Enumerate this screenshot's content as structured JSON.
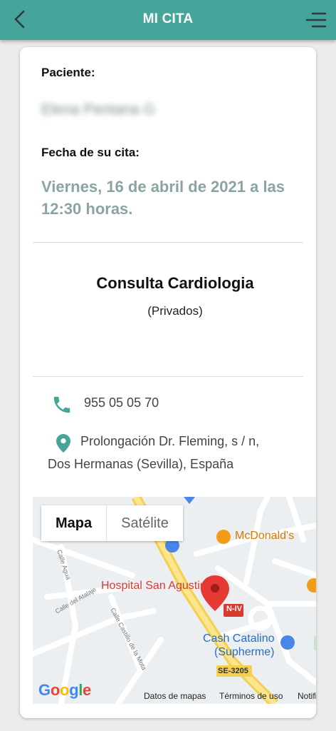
{
  "header": {
    "title": "MI CITA",
    "back_icon": "chevron-left-icon",
    "menu_icon": "menu-icon",
    "color": "#45a59b"
  },
  "appointment": {
    "patient_label": "Paciente:",
    "patient_name": "Elena Pentana G",
    "date_label": "Fecha de su cita:",
    "date_value": "Viernes, 16 de abril de 2021 a las 12:30 horas.",
    "service_name": "Consulta Cardiologia",
    "service_type": "(Privados)",
    "phone": "955 05 05 70",
    "address_line1": "Prolongación Dr. Fleming, s / n,",
    "address_line2": "Dos Hermanas (Sevilla), España"
  },
  "map": {
    "type_map": "Mapa",
    "type_satellite": "Satélite",
    "poi_mcdonalds": "McDonald's",
    "poi_hospital": "Hospital San Agustin",
    "poi_cash1": "Cash Catalino",
    "poi_cash2": "(Supherme)",
    "road_niv": "N-IV",
    "road_se3205": "SE-3205",
    "street_agua": "Calle Agua",
    "street_atalaje": "Calle del Atalaje",
    "street_castillo": "Calle Castillo de la Mota",
    "google": [
      "G",
      "o",
      "o",
      "g",
      "l",
      "e"
    ],
    "attribution_data": "Datos de mapas",
    "attribution_terms": "Términos de uso",
    "attribution_report": "Notificar"
  }
}
